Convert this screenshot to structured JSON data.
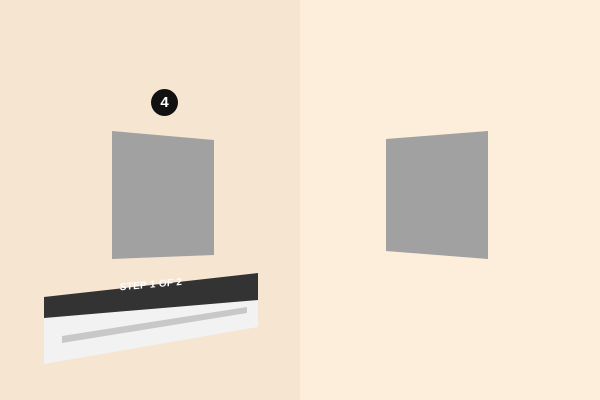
{
  "scene": {
    "left_wall_color": "#F5E5D1",
    "right_wall_color": "#FCEEDB",
    "panel_color": "#A1A1A1"
  },
  "step_badge": {
    "number": "4"
  },
  "step_card": {
    "label": "STEP 1 OF 2",
    "progress": 0.5,
    "header_color": "#333333",
    "body_color": "#F2F2F2",
    "track_color": "#C8C8C8"
  }
}
